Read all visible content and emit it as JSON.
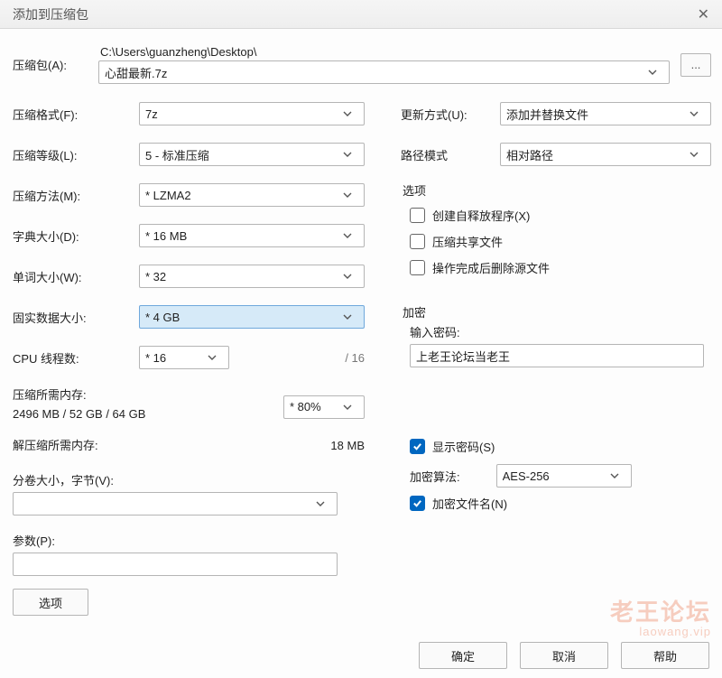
{
  "title": "添加到压缩包",
  "archive": {
    "label": "压缩包(A):",
    "path_prefix": "C:\\Users\\guanzheng\\Desktop\\",
    "filename": "心甜最新.7z"
  },
  "left": {
    "format": {
      "label": "压缩格式(F):",
      "value": "7z"
    },
    "level": {
      "label": "压缩等级(L):",
      "value": "5 - 标准压缩"
    },
    "method": {
      "label": "压缩方法(M):",
      "value": "* LZMA2"
    },
    "dict": {
      "label": "字典大小(D):",
      "value": "* 16 MB"
    },
    "word": {
      "label": "单词大小(W):",
      "value": "* 32"
    },
    "solid": {
      "label": "固实数据大小:",
      "value": "* 4 GB"
    },
    "cpu": {
      "label": "CPU 线程数:",
      "value": "* 16",
      "max": "/ 16"
    },
    "mem_compress": {
      "label": "压缩所需内存:",
      "value": "2496 MB / 52 GB / 64 GB",
      "pct": "* 80%"
    },
    "mem_decompress": {
      "label": "解压缩所需内存:",
      "value": "18 MB"
    },
    "split": {
      "label": "分卷大小，字节(V):"
    },
    "params": {
      "label": "参数(P):"
    },
    "options_btn": "选项"
  },
  "right": {
    "update": {
      "label": "更新方式(U):",
      "value": "添加并替换文件"
    },
    "pathmode": {
      "label": "路径模式",
      "value": "相对路径"
    },
    "options": {
      "legend": "选项",
      "sfx": "创建自释放程序(X)",
      "shared": "压缩共享文件",
      "del_after": "操作完成后删除源文件"
    },
    "encrypt": {
      "legend": "加密",
      "pw_label": "输入密码:",
      "pw_value": "上老王论坛当老王",
      "show_pw": "显示密码(S)",
      "algo_label": "加密算法:",
      "algo_value": "AES-256",
      "enc_names": "加密文件名(N)"
    }
  },
  "footer": {
    "ok": "确定",
    "cancel": "取消",
    "help": "帮助"
  },
  "watermark": {
    "main": "老王论坛",
    "sub": "laowang.vip"
  }
}
